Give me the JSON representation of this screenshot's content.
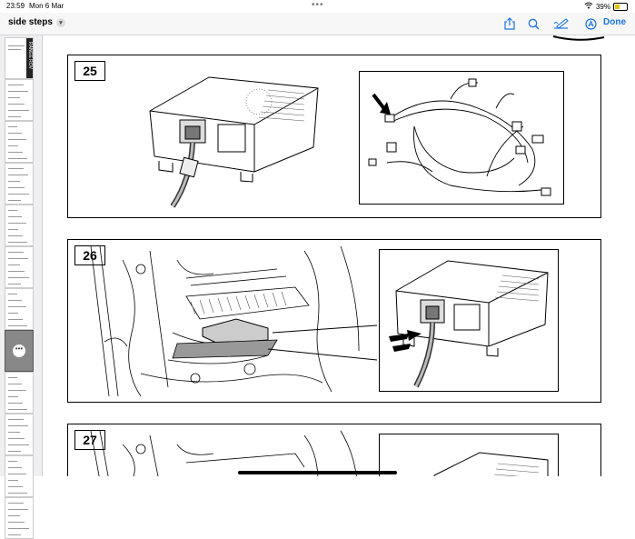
{
  "status": {
    "time": "23:59",
    "date": "Mon 6 Mar",
    "battery": "39%",
    "battery_level": 0.39
  },
  "toolbar": {
    "title": "side steps",
    "done": "Done"
  },
  "icons": [
    "share-icon",
    "search-icon",
    "markup-icon",
    "accessibility-icon"
  ],
  "sidebar": {
    "thumbnail_count": 12,
    "active_index": 7,
    "cover_text": "RANGE ROV"
  },
  "steps": [
    {
      "number": "25"
    },
    {
      "number": "26"
    },
    {
      "number": "27"
    }
  ]
}
